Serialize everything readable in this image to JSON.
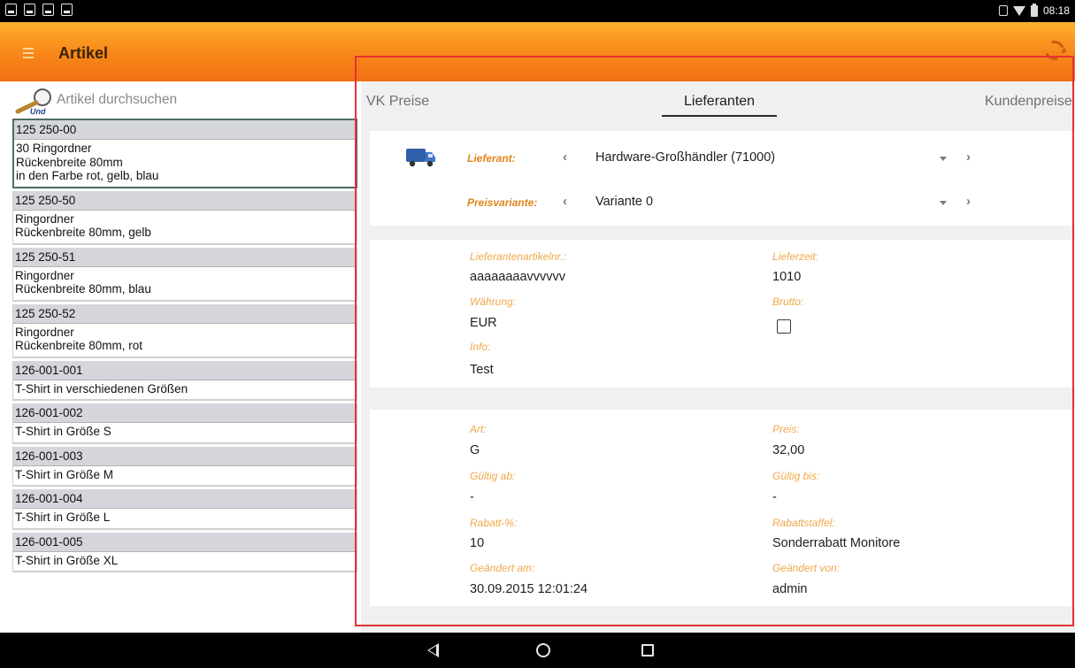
{
  "status_bar": {
    "time": "08:18"
  },
  "app_bar": {
    "title": "Artikel"
  },
  "search": {
    "placeholder": "Artikel durchsuchen",
    "icon_text": "Und"
  },
  "articles": [
    {
      "number": "125 250-00",
      "description": "30 Ringordner\nRückenbreite 80mm\nin den Farbe rot, gelb, blau",
      "selected": true
    },
    {
      "number": "125 250-50",
      "description": "Ringordner\nRückenbreite 80mm, gelb",
      "selected": false
    },
    {
      "number": "125 250-51",
      "description": "Ringordner\nRückenbreite 80mm, blau",
      "selected": false
    },
    {
      "number": "125 250-52",
      "description": "Ringordner\nRückenbreite 80mm, rot",
      "selected": false
    },
    {
      "number": "126-001-001",
      "description": "T-Shirt in verschiedenen Größen",
      "selected": false
    },
    {
      "number": "126-001-002",
      "description": "T-Shirt in Größe S",
      "selected": false
    },
    {
      "number": "126-001-003",
      "description": "T-Shirt in Größe M",
      "selected": false
    },
    {
      "number": "126-001-004",
      "description": "T-Shirt in Größe L",
      "selected": false
    },
    {
      "number": "126-001-005",
      "description": "T-Shirt in Größe XL",
      "selected": false
    }
  ],
  "tabs": [
    {
      "label": "VK Preise",
      "active": false
    },
    {
      "label": "Lieferanten",
      "active": true
    },
    {
      "label": "Kundenpreise",
      "active": false
    }
  ],
  "supplier": {
    "lieferant_label": "Lieferant:",
    "lieferant_value": "Hardware-Großhändler (71000)",
    "preisvariante_label": "Preisvariante:",
    "preisvariante_value": "Variante 0"
  },
  "details": {
    "lieferantenartikelnr_label": "Lieferantenartikelnr.:",
    "lieferantenartikelnr_value": "aaaaaaaavvvvvv",
    "lieferzeit_label": "Lieferzeit:",
    "lieferzeit_value": "1010",
    "waehrung_label": "Währung:",
    "waehrung_value": "EUR",
    "brutto_label": "Brutto:",
    "brutto_checked": false,
    "info_label": "Info:",
    "info_value": "Test"
  },
  "price": {
    "art_label": "Art:",
    "art_value": "G",
    "preis_label": "Preis:",
    "preis_value": "32,00",
    "gueltig_ab_label": "Gültig ab:",
    "gueltig_ab_value": "-",
    "gueltig_bis_label": "Gültig bis:",
    "gueltig_bis_value": "-",
    "rabatt_label": "Rabatt-%:",
    "rabatt_value": "10",
    "rabattstaffel_label": "Rabattstaffel:",
    "rabattstaffel_value": "Sonderrabatt Monitore",
    "geaendert_am_label": "Geändert am:",
    "geaendert_am_value": "30.09.2015 12:01:24",
    "geaendert_von_label": "Geändert von:",
    "geaendert_von_value": "admin"
  },
  "colors": {
    "accent_orange": "#f98c1c",
    "label_orange": "#f0a84a",
    "highlight_red": "#e53232"
  }
}
